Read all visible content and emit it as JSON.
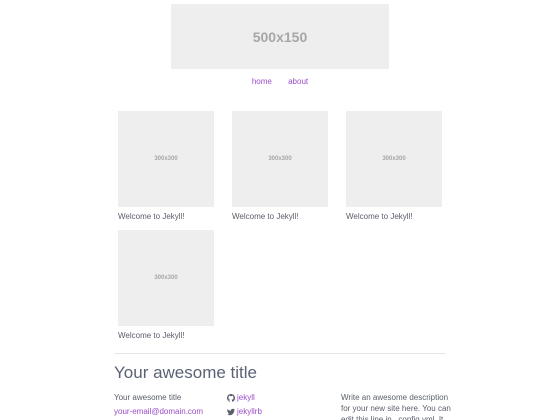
{
  "header": {
    "banner_text": "500x150",
    "nav": [
      {
        "label": "home"
      },
      {
        "label": "about"
      }
    ]
  },
  "posts": [
    {
      "image_text": "300x300",
      "title": "Welcome to Jekyll!"
    },
    {
      "image_text": "300x300",
      "title": "Welcome to Jekyll!"
    },
    {
      "image_text": "300x300",
      "title": "Welcome to Jekyll!"
    },
    {
      "image_text": "300x300",
      "title": "Welcome to Jekyll!"
    }
  ],
  "footer": {
    "title": "Your awesome title",
    "site_title": "Your awesome title",
    "email": "your-email@domain.com",
    "github_username": "jekyll",
    "twitter_username": "jekyllrb",
    "description": "Write an awesome description for your new site here. You can edit this line in _config.yml. It will"
  },
  "colors": {
    "link": "#9b4dca",
    "placeholder_bg": "#eeeeee",
    "placeholder_text": "#a6a6a6",
    "body_text": "#5a5f6b"
  },
  "icons": {
    "github": "github-icon",
    "twitter": "twitter-icon"
  }
}
